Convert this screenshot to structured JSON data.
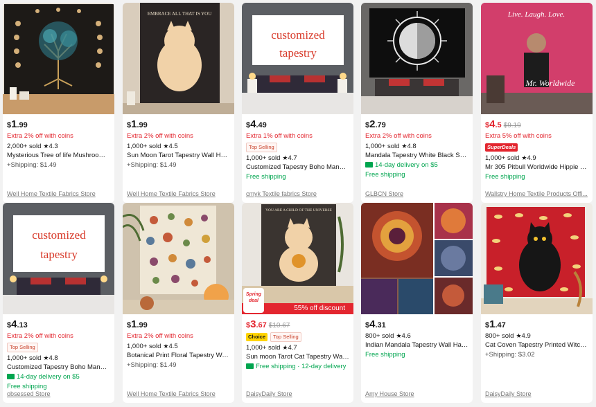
{
  "products": [
    {
      "currency": "$",
      "price_int": "1",
      "price_dec": ".99",
      "orig_price": "",
      "extra": "Extra 2% off with coins",
      "badges": [],
      "sold": "2,000+ sold",
      "rating": "4.3",
      "title": "Mysterious Tree of life Mushroom ...",
      "shipping": "+Shipping: $1.49",
      "delivery": "",
      "store": "Well Home Textile Fabrics Store",
      "image": "tree-of-life-tapestry"
    },
    {
      "currency": "$",
      "price_int": "1",
      "price_dec": ".99",
      "orig_price": "",
      "extra": "Extra 2% off with coins",
      "badges": [],
      "sold": "1,000+ sold",
      "rating": "4.5",
      "title": "Sun Moon Tarot Tapestry Wall Han...",
      "shipping": "+Shipping: $1.49",
      "delivery": "",
      "store": "Well Home Textile Fabrics Store",
      "image": "cat-moon-tapestry",
      "image_text": "EMBRACE ALL THAT IS YOU"
    },
    {
      "currency": "$",
      "price_int": "4",
      "price_dec": ".49",
      "orig_price": "",
      "extra": "Extra 1% off with coins",
      "badges": [
        "Top Selling"
      ],
      "sold": "1,000+ sold",
      "rating": "4.7",
      "title": "Customized Tapestry Boho Mandal...",
      "shipping": "Free shipping",
      "delivery": "",
      "store": "cmyk Textile fabrics Store",
      "image": "customized-tapestry",
      "image_text": [
        "customized",
        "tapestry"
      ]
    },
    {
      "currency": "$",
      "price_int": "2",
      "price_dec": ".79",
      "orig_price": "",
      "extra": "Extra 2% off with coins",
      "badges": [],
      "sold": "1,000+ sold",
      "rating": "4.8",
      "title": "Mandala Tapestry White Black Sun ...",
      "shipping": "Free shipping",
      "delivery": "14-day delivery on $5",
      "store": "GLBCN Store",
      "image": "sun-moon-mandala"
    },
    {
      "currency": "$",
      "price_int": "4",
      "price_dec": ".5",
      "orig_price": "$9.19",
      "extra": "Extra 5% off with coins",
      "badges": [
        "SuperDeals"
      ],
      "sold": "1,000+ sold",
      "rating": "4.9",
      "title": "Mr 305 Pitbull Worldwide Hippie Ta...",
      "shipping": "Free shipping",
      "delivery": "",
      "store": "Wallstry Home Textile Products Offi...",
      "image": "mr-worldwide-tapestry",
      "image_text": [
        "Live. Laugh. Love.",
        "Mr. Worldwide"
      ]
    },
    {
      "currency": "$",
      "price_int": "4",
      "price_dec": ".13",
      "orig_price": "",
      "extra": "Extra 2% off with coins",
      "badges": [
        "Top Selling"
      ],
      "sold": "1,000+ sold",
      "rating": "4.8",
      "title": "Customized Tapestry Boho Mandal...",
      "shipping": "Free shipping",
      "delivery": "14-day delivery on $5",
      "store": "obsessed Store",
      "image": "customized-tapestry",
      "image_text": [
        "customized",
        "tapestry"
      ]
    },
    {
      "currency": "$",
      "price_int": "1",
      "price_dec": ".99",
      "orig_price": "",
      "extra": "Extra 2% off with coins",
      "badges": [],
      "sold": "1,000+ sold",
      "rating": "4.5",
      "title": "Botanical Print Floral Tapestry Wall ...",
      "shipping": "+Shipping: $1.49",
      "delivery": "",
      "store": "Well Home Textile Fabrics Store",
      "image": "botanical-tapestry"
    },
    {
      "currency": "$",
      "price_int": "3",
      "price_dec": ".67",
      "orig_price": "$10.67",
      "extra": "",
      "badges": [
        "Choice",
        "Top Selling"
      ],
      "sold": "1,000+ sold",
      "rating": "4.7",
      "title": "Sun moon Tarot Cat Tapestry Wall ...",
      "shipping": "",
      "delivery": "Free shipping · 12-day delivery",
      "store": "DaisyDaily Store",
      "image": "cat-tarot-tapestry",
      "image_text": "YOU ARE A CHILD OF THE UNIVERSE",
      "promo_banner": "55% off discount",
      "promo_sticker": "Spring deal"
    },
    {
      "currency": "$",
      "price_int": "4",
      "price_dec": ".31",
      "orig_price": "",
      "extra": "",
      "badges": [],
      "sold": "800+ sold",
      "rating": "4.6",
      "title": "Indian Mandala Tapestry Wall Hang...",
      "shipping": "Free shipping",
      "delivery": "",
      "store": "Amy House Store",
      "image": "indian-mandala-collage"
    },
    {
      "currency": "$",
      "price_int": "1",
      "price_dec": ".47",
      "orig_price": "",
      "extra": "",
      "badges": [],
      "sold": "800+ sold",
      "rating": "4.9",
      "title": "Cat Coven Tapestry Printed Witchcr...",
      "shipping": "+Shipping: $3.02",
      "delivery": "",
      "store": "DaisyDaily Store",
      "image": "cat-coven-tapestry"
    }
  ],
  "colors": {
    "sale_red": "#e3262f",
    "free_ship_green": "#00a54f",
    "page_bg": "#f2f2f2"
  },
  "star_glyph": "★"
}
